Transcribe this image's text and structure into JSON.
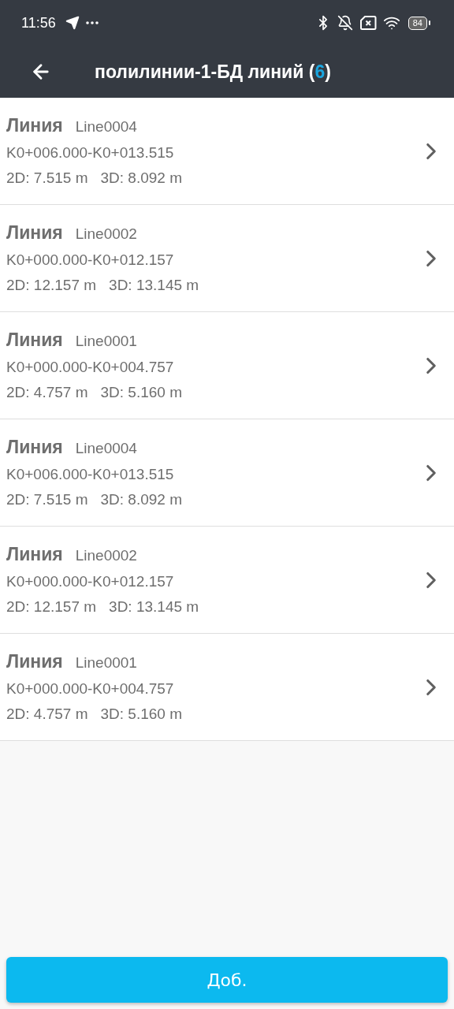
{
  "status_bar": {
    "time": "11:56",
    "battery": "84"
  },
  "header": {
    "title_prefix": "полилинии-1-БД линий (",
    "count": "6",
    "title_suffix": ")"
  },
  "lines": [
    {
      "type": "Линия",
      "name": "Line0004",
      "range": "K0+006.000-K0+013.515",
      "len2d": "2D: 7.515 m",
      "len3d": "3D: 8.092 m"
    },
    {
      "type": "Линия",
      "name": "Line0002",
      "range": "K0+000.000-K0+012.157",
      "len2d": "2D: 12.157 m",
      "len3d": "3D: 13.145 m"
    },
    {
      "type": "Линия",
      "name": "Line0001",
      "range": "K0+000.000-K0+004.757",
      "len2d": "2D: 4.757 m",
      "len3d": "3D: 5.160 m"
    },
    {
      "type": "Линия",
      "name": "Line0004",
      "range": "K0+006.000-K0+013.515",
      "len2d": "2D: 7.515 m",
      "len3d": "3D: 8.092 m"
    },
    {
      "type": "Линия",
      "name": "Line0002",
      "range": "K0+000.000-K0+012.157",
      "len2d": "2D: 12.157 m",
      "len3d": "3D: 13.145 m"
    },
    {
      "type": "Линия",
      "name": "Line0001",
      "range": "K0+000.000-K0+004.757",
      "len2d": "2D: 4.757 m",
      "len3d": "3D: 5.160 m"
    }
  ],
  "add_button": "Доб."
}
